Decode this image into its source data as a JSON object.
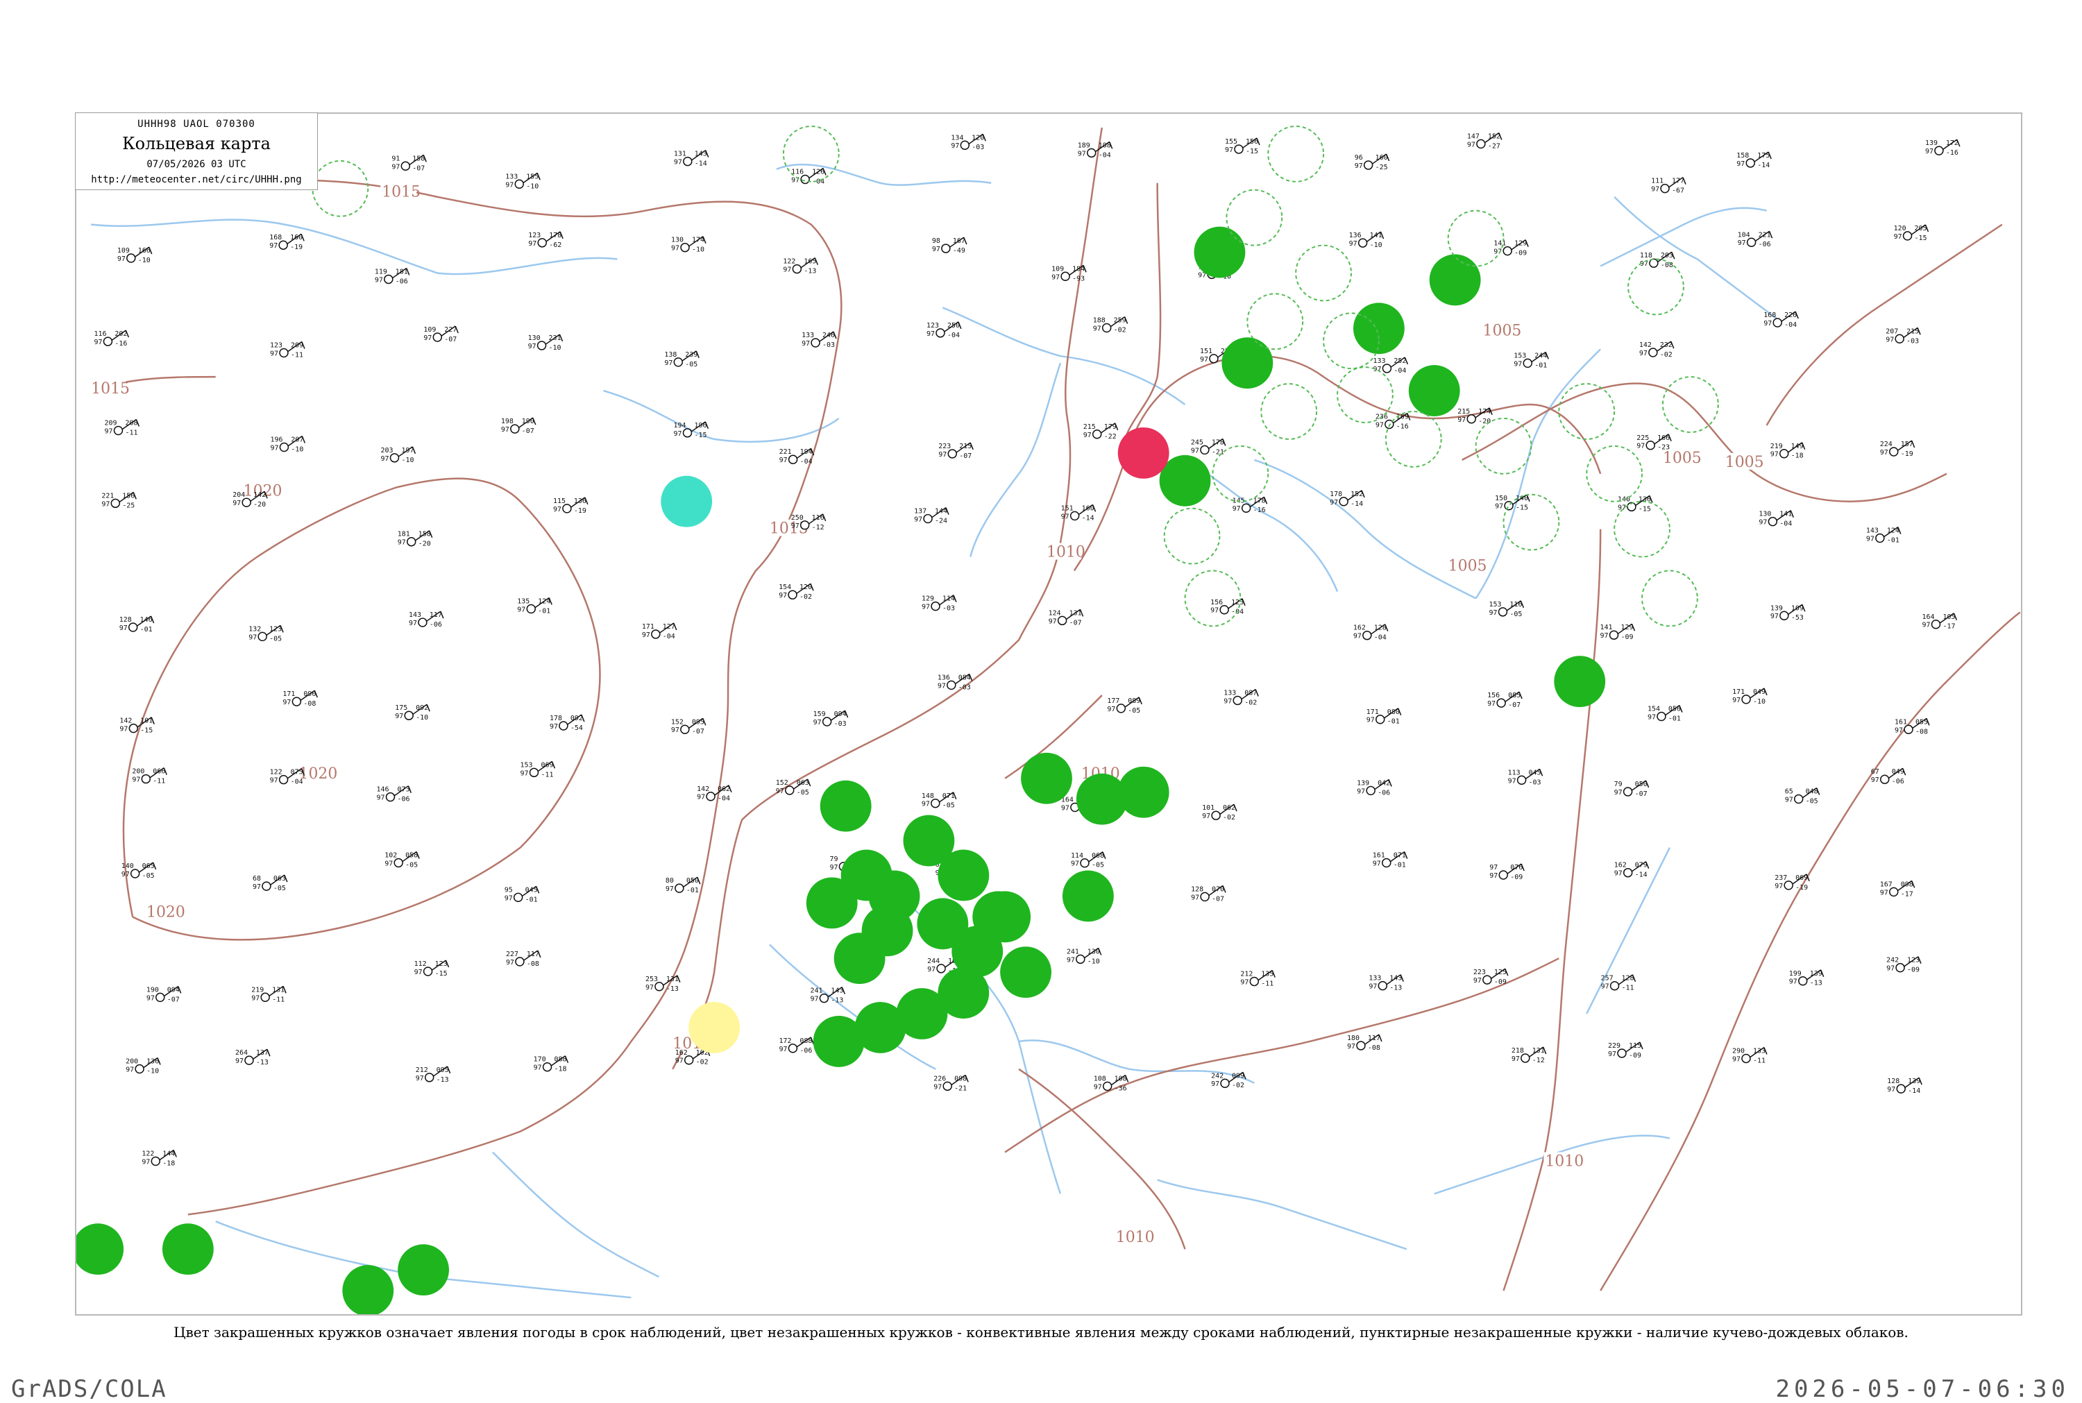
{
  "title_box": {
    "code_line": "UHHH98  UAOL  070300",
    "title": "Кольцевая карта",
    "date": "07/05/2026 03 UTC",
    "url": "http://meteocenter.net/circ/UHHH.png"
  },
  "caption": "Цвет закрашенных кружков означает явления погоды в срок наблюдений, цвет незакрашенных кружков - конвективные явления между сроками наблюдений, пунктирные незакрашенные кружки - наличие кучево-дождевых облаков.",
  "footer": {
    "left": "GrADS/COLA",
    "right": "2026-05-07-06:30"
  },
  "colors": {
    "isobar": "#b5776b",
    "coast": "#b5776b",
    "river": "#9cc8ee",
    "rain": "#1fb51f",
    "rain_dashed": "#55bb55",
    "fog": "#e8305a",
    "haze": "#40e0c8",
    "dust": "#fff59a"
  },
  "isobar_labels": [
    "1015",
    "1015",
    "1020",
    "1020",
    "1020",
    "1015",
    "1015",
    "1010",
    "1010",
    "1010",
    "1005",
    "1005",
    "1005",
    "1005",
    "1010"
  ],
  "filled_circle_colors": [
    "rain",
    "rain",
    "rain",
    "rain",
    "rain",
    "rain",
    "rain",
    "rain",
    "rain",
    "rain",
    "rain",
    "rain",
    "rain",
    "rain",
    "rain",
    "rain",
    "rain",
    "rain",
    "rain",
    "rain",
    "rain",
    "rain",
    "rain",
    "rain",
    "rain",
    "rain",
    "rain",
    "rain",
    "rain",
    "rain",
    "rain",
    "rain",
    "fog",
    "haze",
    "dust"
  ],
  "stations": [
    {
      "t": "171",
      "p": "97",
      "d": "-11",
      "s": "94"
    },
    {
      "t": "171",
      "p": "97",
      "d": "-09",
      "s": "182"
    },
    {
      "t": "158",
      "p": "97",
      "d": "-07",
      "s": "91"
    },
    {
      "t": "155",
      "p": "97",
      "d": "-10",
      "s": "133"
    },
    {
      "t": "143",
      "p": "97",
      "d": "-14",
      "s": "131"
    },
    {
      "t": "126",
      "p": "97",
      "d": "-04",
      "s": "116"
    },
    {
      "t": "120",
      "p": "97",
      "d": "-03",
      "s": "134"
    },
    {
      "t": "108",
      "p": "97",
      "d": "-04",
      "s": "189"
    },
    {
      "t": "156",
      "p": "97",
      "d": "-15",
      "s": "155"
    },
    {
      "t": "160",
      "p": "97",
      "d": "-25",
      "s": "96"
    },
    {
      "t": "152",
      "p": "97",
      "d": "-27",
      "s": "147"
    },
    {
      "t": "177",
      "p": "97",
      "d": "-67",
      "s": "111"
    },
    {
      "t": "175",
      "p": "97",
      "d": "-14",
      "s": "158"
    },
    {
      "t": "172",
      "p": "97",
      "d": "-16",
      "s": "139"
    },
    {
      "t": "166",
      "p": "97",
      "d": "-10",
      "s": "109"
    },
    {
      "t": "160",
      "p": "97",
      "d": "-19",
      "s": "168"
    },
    {
      "t": "181",
      "p": "97",
      "d": "-06",
      "s": "119"
    },
    {
      "t": "178",
      "p": "97",
      "d": "-62",
      "s": "123"
    },
    {
      "t": "174",
      "p": "97",
      "d": "-10",
      "s": "130"
    },
    {
      "t": "165",
      "p": "97",
      "d": "-13",
      "s": "122"
    },
    {
      "t": "167",
      "p": "97",
      "d": "-49",
      "s": "98"
    },
    {
      "t": "184",
      "p": "97",
      "d": "-93",
      "s": "109"
    },
    {
      "t": "171",
      "p": "97",
      "d": "-10",
      "s": "136"
    },
    {
      "t": "141",
      "p": "97",
      "d": "-10",
      "s": "136"
    },
    {
      "t": "129",
      "p": "97",
      "d": "-09",
      "s": "141"
    },
    {
      "t": "203",
      "p": "97",
      "d": "-08",
      "s": "118"
    },
    {
      "t": "221",
      "p": "97",
      "d": "-06",
      "s": "104"
    },
    {
      "t": "205",
      "p": "97",
      "d": "-15",
      "s": "120"
    },
    {
      "t": "202",
      "p": "97",
      "d": "-16",
      "s": "116"
    },
    {
      "t": "209",
      "p": "97",
      "d": "-11",
      "s": "123"
    },
    {
      "t": "227",
      "p": "97",
      "d": "-07",
      "s": "109"
    },
    {
      "t": "231",
      "p": "97",
      "d": "-10",
      "s": "130"
    },
    {
      "t": "239",
      "p": "97",
      "d": "-05",
      "s": "138"
    },
    {
      "t": "246",
      "p": "97",
      "d": "-03",
      "s": "133"
    },
    {
      "t": "250",
      "p": "97",
      "d": "-04",
      "s": "123"
    },
    {
      "t": "259",
      "p": "97",
      "d": "-02",
      "s": "188"
    },
    {
      "t": "258",
      "p": "97",
      "d": "-02",
      "s": "151"
    },
    {
      "t": "252",
      "p": "97",
      "d": "-04",
      "s": "133"
    },
    {
      "t": "244",
      "p": "97",
      "d": "-01",
      "s": "153"
    },
    {
      "t": "232",
      "p": "97",
      "d": "-02",
      "s": "142"
    },
    {
      "t": "226",
      "p": "97",
      "d": "-04",
      "s": "168"
    },
    {
      "t": "215",
      "p": "97",
      "d": "-03",
      "s": "207"
    },
    {
      "t": "208",
      "p": "97",
      "d": "-11",
      "s": "209"
    },
    {
      "t": "207",
      "p": "97",
      "d": "-10",
      "s": "196"
    },
    {
      "t": "197",
      "p": "97",
      "d": "-10",
      "s": "203"
    },
    {
      "t": "190",
      "p": "97",
      "d": "-07",
      "s": "198"
    },
    {
      "t": "196",
      "p": "97",
      "d": "-15",
      "s": "194"
    },
    {
      "t": "194",
      "p": "97",
      "d": "-04",
      "s": "221"
    },
    {
      "t": "215",
      "p": "97",
      "d": "-07",
      "s": "223"
    },
    {
      "t": "179",
      "p": "97",
      "d": "-22",
      "s": "215"
    },
    {
      "t": "178",
      "p": "97",
      "d": "-21",
      "s": "245"
    },
    {
      "t": "169",
      "p": "97",
      "d": "-16",
      "s": "236"
    },
    {
      "t": "174",
      "p": "97",
      "d": "-20",
      "s": "215"
    },
    {
      "t": "166",
      "p": "97",
      "d": "-23",
      "s": "225"
    },
    {
      "t": "149",
      "p": "97",
      "d": "-18",
      "s": "219"
    },
    {
      "t": "157",
      "p": "97",
      "d": "-19",
      "s": "224"
    },
    {
      "t": "156",
      "p": "97",
      "d": "-25",
      "s": "221"
    },
    {
      "t": "142",
      "p": "97",
      "d": "-20",
      "s": "204"
    },
    {
      "t": "158",
      "p": "97",
      "d": "-20",
      "s": "181"
    },
    {
      "t": "136",
      "p": "97",
      "d": "-19",
      "s": "115"
    },
    {
      "t": "130",
      "p": "97",
      "d": "-17",
      "s": "115"
    },
    {
      "t": "116",
      "p": "97",
      "d": "-12",
      "s": "250"
    },
    {
      "t": "144",
      "p": "97",
      "d": "-24",
      "s": "137"
    },
    {
      "t": "160",
      "p": "97",
      "d": "-14",
      "s": "151"
    },
    {
      "t": "178",
      "p": "97",
      "d": "-16",
      "s": "145"
    },
    {
      "t": "152",
      "p": "97",
      "d": "-14",
      "s": "178"
    },
    {
      "t": "140",
      "p": "97",
      "d": "-15",
      "s": "150"
    },
    {
      "t": "136",
      "p": "97",
      "d": "-15",
      "s": "140"
    },
    {
      "t": "141",
      "p": "97",
      "d": "-04",
      "s": "130"
    },
    {
      "t": "124",
      "p": "97",
      "d": "-01",
      "s": "143"
    },
    {
      "t": "146",
      "p": "97",
      "d": "-01",
      "s": "128"
    },
    {
      "t": "123",
      "p": "97",
      "d": "-05",
      "s": "132"
    },
    {
      "t": "117",
      "p": "97",
      "d": "-06",
      "s": "143"
    },
    {
      "t": "124",
      "p": "97",
      "d": "-01",
      "s": "135"
    },
    {
      "t": "127",
      "p": "97",
      "d": "-04",
      "s": "171"
    },
    {
      "t": "120",
      "p": "97",
      "d": "-02",
      "s": "154"
    },
    {
      "t": "114",
      "p": "97",
      "d": "-03",
      "s": "129"
    },
    {
      "t": "131",
      "p": "97",
      "d": "-07",
      "s": "124"
    },
    {
      "t": "123",
      "p": "97",
      "d": "-04",
      "s": "156"
    },
    {
      "t": "128",
      "p": "97",
      "d": "-04",
      "s": "162"
    },
    {
      "t": "116",
      "p": "97",
      "d": "-05",
      "s": "153"
    },
    {
      "t": "129",
      "p": "97",
      "d": "-09",
      "s": "141"
    },
    {
      "t": "109",
      "p": "97",
      "d": "-53",
      "s": "139"
    },
    {
      "t": "105",
      "p": "97",
      "d": "-17",
      "s": "164"
    },
    {
      "t": "101",
      "p": "97",
      "d": "-15",
      "s": "142"
    },
    {
      "t": "096",
      "p": "97",
      "d": "-08",
      "s": "171"
    },
    {
      "t": "092",
      "p": "97",
      "d": "-10",
      "s": "175"
    },
    {
      "t": "092",
      "p": "97",
      "d": "-54",
      "s": "178"
    },
    {
      "t": "095",
      "p": "97",
      "d": "-07",
      "s": "152"
    },
    {
      "t": "094",
      "p": "97",
      "d": "-03",
      "s": "159"
    },
    {
      "t": "084",
      "p": "97",
      "d": "-03",
      "s": "136"
    },
    {
      "t": "089",
      "p": "97",
      "d": "-05",
      "s": "177"
    },
    {
      "t": "087",
      "p": "97",
      "d": "-02",
      "s": "133"
    },
    {
      "t": "080",
      "p": "97",
      "d": "-01",
      "s": "171"
    },
    {
      "t": "085",
      "p": "97",
      "d": "-07",
      "s": "156"
    },
    {
      "t": "056",
      "p": "97",
      "d": "-01",
      "s": "154"
    },
    {
      "t": "049",
      "p": "97",
      "d": "-10",
      "s": "171"
    },
    {
      "t": "055",
      "p": "97",
      "d": "-08",
      "s": "161"
    },
    {
      "t": "066",
      "p": "97",
      "d": "-11",
      "s": "200"
    },
    {
      "t": "075",
      "p": "97",
      "d": "-04",
      "s": "122"
    },
    {
      "t": "073",
      "p": "97",
      "d": "-06",
      "s": "146"
    },
    {
      "t": "069",
      "p": "97",
      "d": "-11",
      "s": "153"
    },
    {
      "t": "062",
      "p": "97",
      "d": "-04",
      "s": "142"
    },
    {
      "t": "063",
      "p": "97",
      "d": "-05",
      "s": "152"
    },
    {
      "t": "071",
      "p": "97",
      "d": "-05",
      "s": "148"
    },
    {
      "t": "076",
      "p": "97",
      "d": "-07",
      "s": "164"
    },
    {
      "t": "062",
      "p": "97",
      "d": "-02",
      "s": "101"
    },
    {
      "t": "042",
      "p": "97",
      "d": "-06",
      "s": "139"
    },
    {
      "t": "045",
      "p": "97",
      "d": "-03",
      "s": "113"
    },
    {
      "t": "050",
      "p": "97",
      "d": "-07",
      "s": "79"
    },
    {
      "t": "048",
      "p": "97",
      "d": "-05",
      "s": "65"
    },
    {
      "t": "049",
      "p": "97",
      "d": "-06",
      "s": "67"
    },
    {
      "t": "065",
      "p": "97",
      "d": "-05",
      "s": "140"
    },
    {
      "t": "063",
      "p": "97",
      "d": "-05",
      "s": "68"
    },
    {
      "t": "058",
      "p": "97",
      "d": "-05",
      "s": "102"
    },
    {
      "t": "045",
      "p": "97",
      "d": "-01",
      "s": "95"
    },
    {
      "t": "050",
      "p": "97",
      "d": "-01",
      "s": "80"
    },
    {
      "t": "059",
      "p": "97",
      "d": "-08",
      "s": "79"
    },
    {
      "t": "056",
      "p": "97",
      "d": "-01",
      "s": "63"
    },
    {
      "t": "068",
      "p": "97",
      "d": "-05",
      "s": "114"
    },
    {
      "t": "070",
      "p": "97",
      "d": "-07",
      "s": "128"
    },
    {
      "t": "071",
      "p": "97",
      "d": "-01",
      "s": "161"
    },
    {
      "t": "076",
      "p": "97",
      "d": "-09",
      "s": "97"
    },
    {
      "t": "079",
      "p": "97",
      "d": "-14",
      "s": "162"
    },
    {
      "t": "069",
      "p": "97",
      "d": "-19",
      "s": "237"
    },
    {
      "t": "098",
      "p": "97",
      "d": "-17",
      "s": "167"
    },
    {
      "t": "094",
      "p": "97",
      "d": "-07",
      "s": "190"
    },
    {
      "t": "131",
      "p": "97",
      "d": "-11",
      "s": "219"
    },
    {
      "t": "123",
      "p": "97",
      "d": "-15",
      "s": "112"
    },
    {
      "t": "117",
      "p": "97",
      "d": "-08",
      "s": "227"
    },
    {
      "t": "131",
      "p": "97",
      "d": "-13",
      "s": "253"
    },
    {
      "t": "143",
      "p": "97",
      "d": "-13",
      "s": "241"
    },
    {
      "t": "107",
      "p": "97",
      "d": "-13",
      "s": "244"
    },
    {
      "t": "130",
      "p": "97",
      "d": "-10",
      "s": "241"
    },
    {
      "t": "135",
      "p": "97",
      "d": "-11",
      "s": "212"
    },
    {
      "t": "143",
      "p": "97",
      "d": "-13",
      "s": "133"
    },
    {
      "t": "125",
      "p": "97",
      "d": "-09",
      "s": "223"
    },
    {
      "t": "128",
      "p": "97",
      "d": "-11",
      "s": "257"
    },
    {
      "t": "139",
      "p": "97",
      "d": "-13",
      "s": "199"
    },
    {
      "t": "123",
      "p": "97",
      "d": "-09",
      "s": "242"
    },
    {
      "t": "136",
      "p": "97",
      "d": "-10",
      "s": "200"
    },
    {
      "t": "137",
      "p": "97",
      "d": "-13",
      "s": "264"
    },
    {
      "t": "095",
      "p": "97",
      "d": "-13",
      "s": "212"
    },
    {
      "t": "088",
      "p": "97",
      "d": "-18",
      "s": "170"
    },
    {
      "t": "102",
      "p": "97",
      "d": "-02",
      "s": "162"
    },
    {
      "t": "088",
      "p": "97",
      "d": "-06",
      "s": "172"
    },
    {
      "t": "098",
      "p": "97",
      "d": "-21",
      "s": "226"
    },
    {
      "t": "108",
      "p": "97",
      "d": "-36",
      "s": "108"
    },
    {
      "t": "099",
      "p": "97",
      "d": "-02",
      "s": "242"
    },
    {
      "t": "117",
      "p": "97",
      "d": "-08",
      "s": "180"
    },
    {
      "t": "131",
      "p": "97",
      "d": "-12",
      "s": "218"
    },
    {
      "t": "115",
      "p": "97",
      "d": "-09",
      "s": "229"
    },
    {
      "t": "133",
      "p": "97",
      "d": "-11",
      "s": "290"
    },
    {
      "t": "139",
      "p": "97",
      "d": "-14",
      "s": "128"
    },
    {
      "t": "144",
      "p": "97",
      "d": "-18",
      "s": "122"
    }
  ]
}
